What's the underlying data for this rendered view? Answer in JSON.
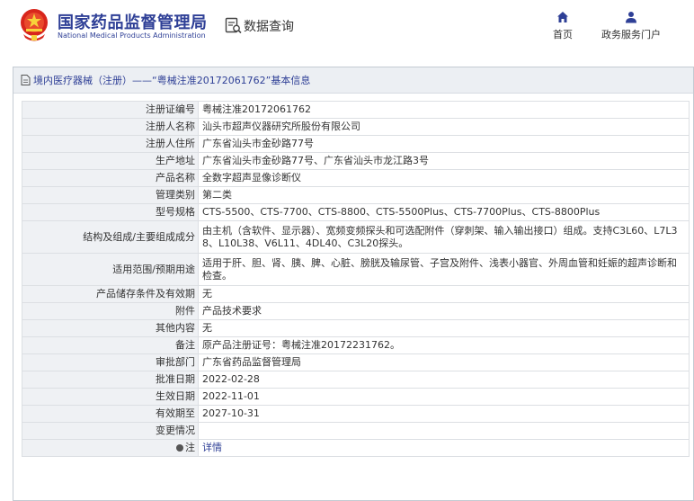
{
  "header": {
    "org_cn": "国家药品监督管理局",
    "org_en": "National Medical Products Administration",
    "data_query": "数据查询",
    "nav": [
      {
        "label": "首页",
        "icon": "home-icon"
      },
      {
        "label": "政务服务门户",
        "icon": "user-icon"
      }
    ]
  },
  "panel": {
    "title": "境内医疗器械（注册）——“粤械注准20172061762”基本信息"
  },
  "rows": [
    {
      "label": "注册证编号",
      "value": "粤械注准20172061762"
    },
    {
      "label": "注册人名称",
      "value": "汕头市超声仪器研究所股份有限公司"
    },
    {
      "label": "注册人住所",
      "value": "广东省汕头市金砂路77号"
    },
    {
      "label": "生产地址",
      "value": "广东省汕头市金砂路77号、广东省汕头市龙江路3号"
    },
    {
      "label": "产品名称",
      "value": "全数字超声显像诊断仪"
    },
    {
      "label": "管理类别",
      "value": "第二类"
    },
    {
      "label": "型号规格",
      "value": "CTS-5500、CTS-7700、CTS-8800、CTS-5500Plus、CTS-7700Plus、CTS-8800Plus"
    },
    {
      "label": "结构及组成/主要组成成分",
      "value": "由主机（含软件、显示器）、宽频变频探头和可选配附件（穿刺架、输入输出接口）组成。支持C3L60、L7L38、L10L38、V6L11、4DL40、C3L20探头。"
    },
    {
      "label": "适用范围/预期用途",
      "value": "适用于肝、胆、肾、胰、脾、心脏、膀胱及输尿管、子宫及附件、浅表小器官、外周血管和妊娠的超声诊断和检查。"
    },
    {
      "label": "产品储存条件及有效期",
      "value": "无"
    },
    {
      "label": "附件",
      "value": "产品技术要求"
    },
    {
      "label": "其他内容",
      "value": "无"
    },
    {
      "label": "备注",
      "value": "原产品注册证号：粤械注准20172231762。"
    },
    {
      "label": "审批部门",
      "value": "广东省药品监督管理局"
    },
    {
      "label": "批准日期",
      "value": "2022-02-28"
    },
    {
      "label": "生效日期",
      "value": "2022-11-01"
    },
    {
      "label": "有效期至",
      "value": "2027-10-31"
    },
    {
      "label": "变更情况",
      "value": ""
    },
    {
      "label": "注",
      "value": "详情"
    }
  ],
  "colors": {
    "brand": "#2e3f96",
    "label_bg": "#eff1f4",
    "border": "#dcdfe3"
  }
}
